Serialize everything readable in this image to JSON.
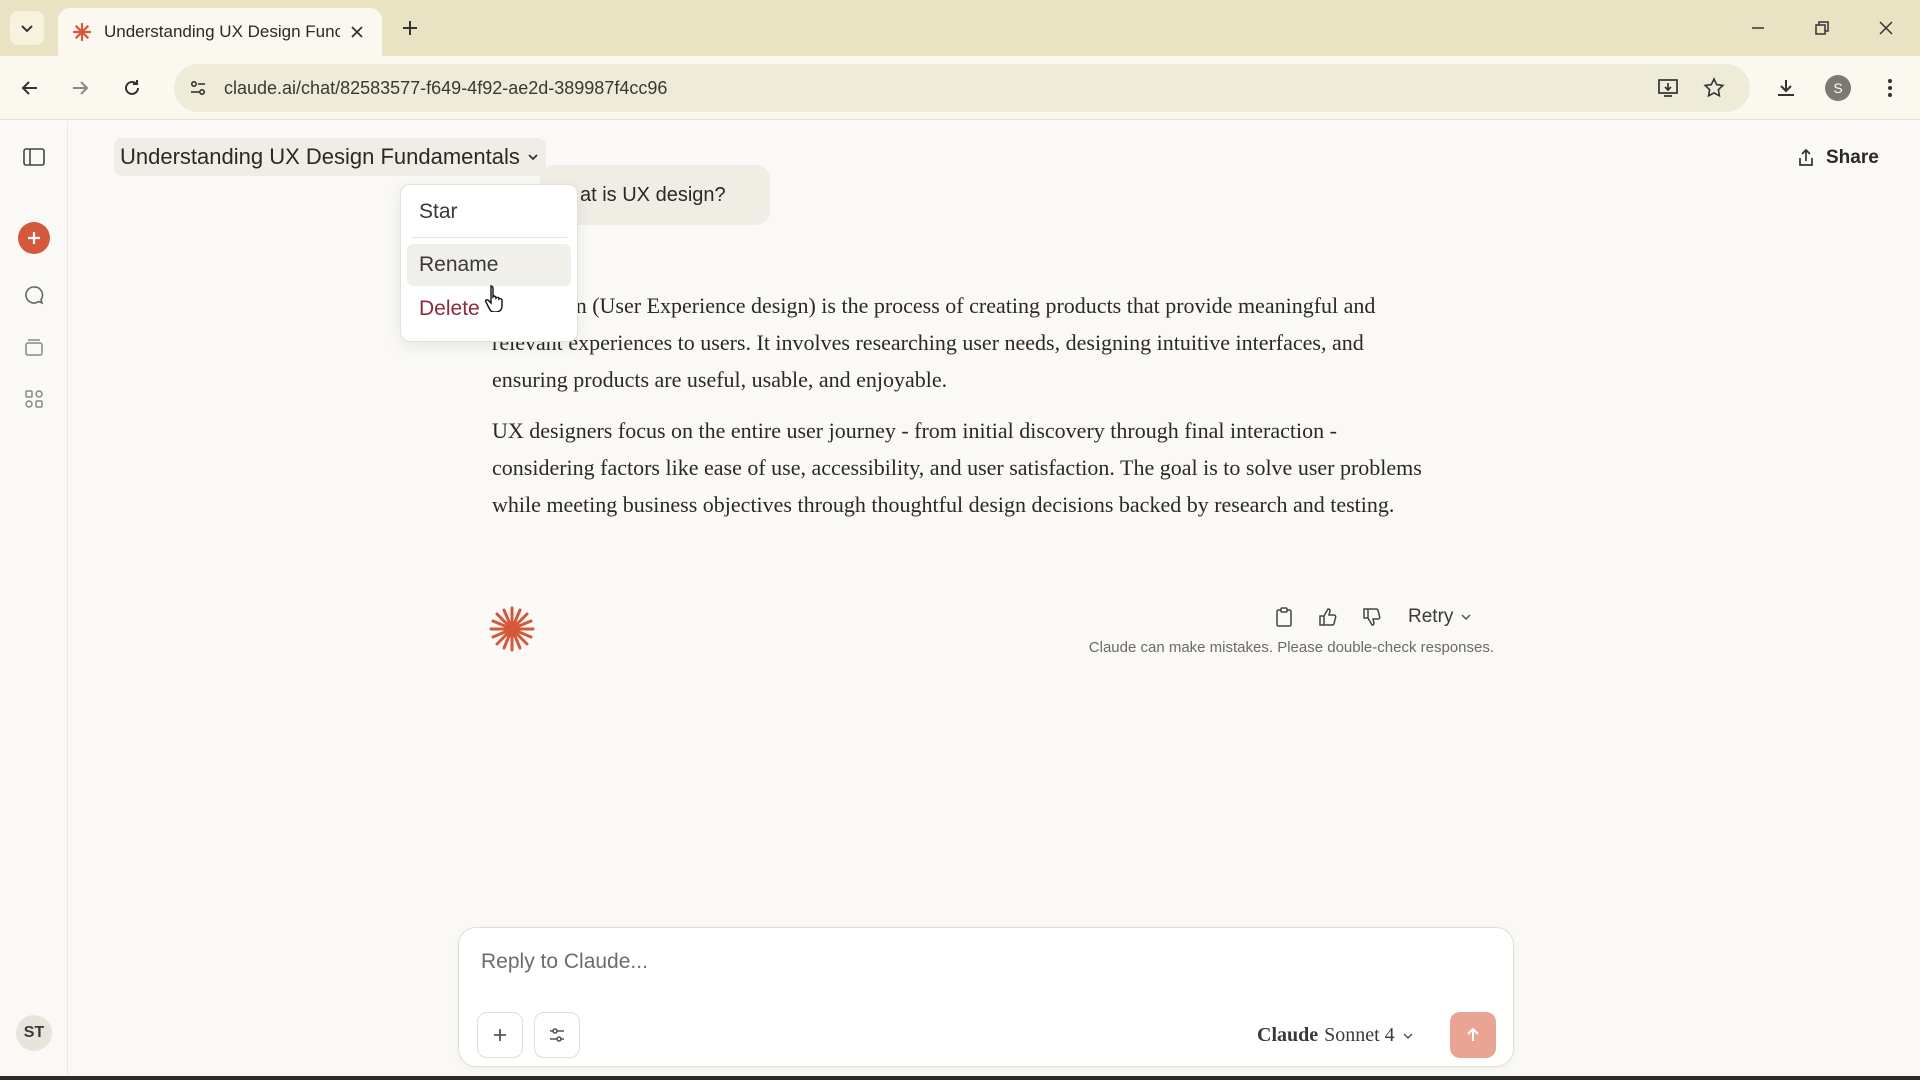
{
  "browser": {
    "tab_title": "Understanding UX Design Func",
    "url": "claude.ai/chat/82583577-f649-4f92-ae2d-389987f4cc96",
    "profile_initial": "S"
  },
  "header": {
    "chat_title": "Understanding UX Design Fundamentals",
    "share_label": "Share"
  },
  "menu": {
    "items": [
      {
        "label": "Star"
      },
      {
        "label": "Rename"
      },
      {
        "label": "Delete"
      }
    ]
  },
  "conversation": {
    "user_message": "at is UX design?",
    "response_paragraphs": [
      "UX design (User Experience design) is the process of creating products that provide meaningful and relevant experiences to users. It involves researching user needs, designing intuitive interfaces, and ensuring products are useful, usable, and enjoyable.",
      "UX designers focus on the entire user journey - from initial discovery through final interaction - considering factors like ease of use, accessibility, and user satisfaction. The goal is to solve user problems while meeting business objectives through thoughtful design decisions backed by research and testing."
    ],
    "retry_label": "Retry",
    "disclaimer": "Claude can make mistakes. Please double-check responses."
  },
  "composer": {
    "placeholder": "Reply to Claude...",
    "model_brand": "Claude",
    "model_name": "Sonnet 4"
  },
  "user": {
    "initials": "ST"
  },
  "colors": {
    "accent": "#d4583b",
    "danger": "#8e2a3a",
    "send_disabled": "#e9a493"
  }
}
